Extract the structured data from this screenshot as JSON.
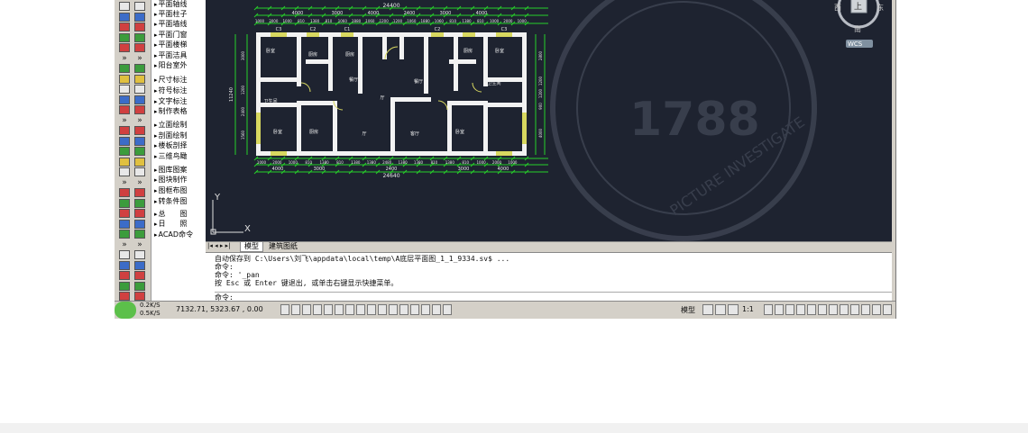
{
  "menu": {
    "items": [
      "平面轴线",
      "平面柱子",
      "平面墙线",
      "平面门窗",
      "平面楼梯",
      "平面洁具",
      "阳台室外",
      "尺寸标注",
      "符号标注",
      "文字标注",
      "制作表格",
      "立面绘制",
      "剖面绘制",
      "楼板剖择",
      "三维鸟瞰",
      "图库图案",
      "图块制作",
      "图框布图",
      "转条件图",
      "总　　图",
      "日　　照",
      "ACAD命令"
    ]
  },
  "plan": {
    "top_total": "24400",
    "top_dims": [
      "4000",
      "3000",
      "4000",
      "2400",
      "3000",
      "4000"
    ],
    "top_small_dims": [
      "1000",
      "2000",
      "1000",
      "810",
      "1380",
      "810",
      "1060",
      "1880",
      "1060",
      "1200",
      "1200",
      "1060",
      "1880",
      "1060",
      "810",
      "1380",
      "810",
      "1000",
      "2000",
      "1000"
    ],
    "window_labels": [
      "C3",
      "C2",
      "C1",
      "C2",
      "C3"
    ],
    "left_dims": [
      "3000",
      "1200",
      "2400",
      "1560"
    ],
    "left_total": "11240",
    "right_dims": [
      "2800",
      "1200",
      "1200",
      "900",
      "4000"
    ],
    "bottom_small_dims": [
      "1000",
      "2000",
      "1000",
      "810",
      "1380",
      "810",
      "1380",
      "1380",
      "2480",
      "1380",
      "1380",
      "810",
      "1380",
      "810",
      "1000",
      "2000",
      "1000"
    ],
    "bottom_dims": [
      "4000",
      "3000",
      "2400",
      "3000",
      "4000"
    ],
    "bottom_total": "24640",
    "room_labels": [
      "卧室",
      "厨房",
      "厨房",
      "厨房",
      "卧室",
      "卫生间",
      "卫生间",
      "餐厅",
      "餐厅",
      "厅",
      "卧室",
      "厨房",
      "厅",
      "客厅",
      "卧室"
    ],
    "ucs_x": "X",
    "ucs_y": "Y"
  },
  "compass": {
    "west": "西",
    "east": "东",
    "south": "南",
    "top": "上",
    "wcs": "WCS"
  },
  "watermark": {
    "number": "1788",
    "ring": "PICTURE INVESTIGATE"
  },
  "tabs": [
    "模型",
    "建筑图纸"
  ],
  "command": {
    "lines": [
      "自动保存到 C:\\Users\\刘飞\\appdata\\local\\temp\\A底层平面图_1_1_9334.sv$ ...",
      "命令:",
      "命令: '_pan",
      "按 Esc 或 Enter 键退出, 或单击右键显示快捷菜单。",
      "命令:"
    ]
  },
  "status": {
    "speed_up": "0.2K/S",
    "speed_down": "0.5K/S",
    "coords": "7132.71,  5323.67 , 0.00",
    "model_label": "模型",
    "scale": "1:1"
  }
}
